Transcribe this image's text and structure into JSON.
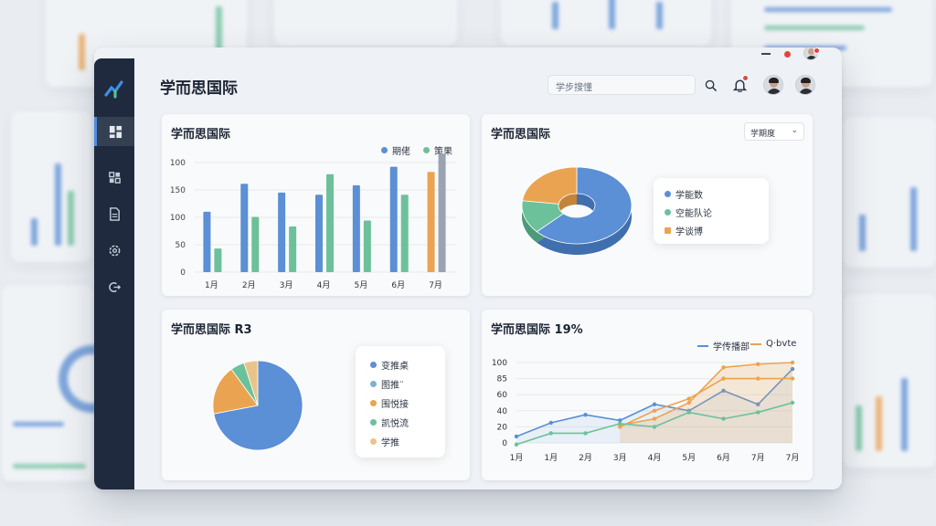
{
  "app": {
    "title": "学而思国际"
  },
  "search": {
    "placeholder": "学步搜懂"
  },
  "sidebar": {
    "items": [
      {
        "name": "dashboard"
      },
      {
        "name": "apps"
      },
      {
        "name": "documents"
      },
      {
        "name": "settings"
      },
      {
        "name": "logout"
      }
    ]
  },
  "colors": {
    "blue": "#5b8fd6",
    "green": "#6cc19a",
    "orange": "#eaa451",
    "gray": "#9aa3b1",
    "sidebar": "#1f2a3f"
  },
  "cards": {
    "bar": {
      "title": "学而思国际",
      "legend": [
        "期佬",
        "策果"
      ]
    },
    "donut": {
      "title": "学而思国际",
      "select": "学期度",
      "legend": [
        "学能数",
        "空能队论",
        "学谈博"
      ]
    },
    "pie": {
      "title": "学而思国际 R3",
      "legend": [
        "变推桌",
        "图推¨",
        "围悦接",
        "凯悦流",
        "学推"
      ]
    },
    "line": {
      "title": "学而思国际 19%",
      "legend": [
        "学传播部",
        "Q·bvte"
      ]
    }
  },
  "chart_data": [
    {
      "type": "bar",
      "categories": [
        "1月",
        "2月",
        "3月",
        "4月",
        "5月",
        "6月",
        "7月"
      ],
      "ylim": [
        0,
        150
      ],
      "yticks": [
        "0",
        "50",
        "100",
        "150",
        "100"
      ],
      "series": [
        {
          "name": "期佬",
          "values": [
            82,
            120,
            108,
            105,
            118,
            143,
            130
          ]
        },
        {
          "name": "策果",
          "values": [
            32,
            75,
            62,
            133,
            70,
            105,
            98
          ]
        }
      ],
      "extra": {
        "july": [
          {
            "color": "#eaa451",
            "value": 136
          },
          {
            "color": "#9aa3b1",
            "value": 161
          }
        ]
      }
    },
    {
      "type": "pie",
      "variant": "donut",
      "values": [
        63,
        14,
        23
      ],
      "labels": [
        "学能数",
        "空能队论",
        "学谈博"
      ]
    },
    {
      "type": "pie",
      "values": [
        72,
        18,
        5,
        5
      ],
      "labels": [
        "变推桌",
        "围悦接",
        "凯悦流",
        "学推"
      ]
    },
    {
      "type": "line",
      "categories": [
        "1月",
        "1月",
        "2月",
        "3月",
        "4月",
        "5月",
        "6月",
        "7月",
        "7月"
      ],
      "yticks": [
        "0",
        "20",
        "40",
        "60",
        "85",
        "100"
      ],
      "series": [
        {
          "name": "学传播部",
          "values": [
            8,
            25,
            35,
            28,
            48,
            40,
            65,
            48,
            92
          ]
        },
        {
          "name": "Q·bvte",
          "values": [
            null,
            null,
            null,
            22,
            30,
            50,
            94,
            98,
            100
          ]
        },
        {
          "name": "",
          "values": [
            null,
            null,
            null,
            20,
            40,
            55,
            80,
            80,
            80
          ]
        },
        {
          "name": "",
          "values": [
            -2,
            12,
            12,
            24,
            20,
            38,
            30,
            38,
            50
          ]
        }
      ]
    }
  ]
}
